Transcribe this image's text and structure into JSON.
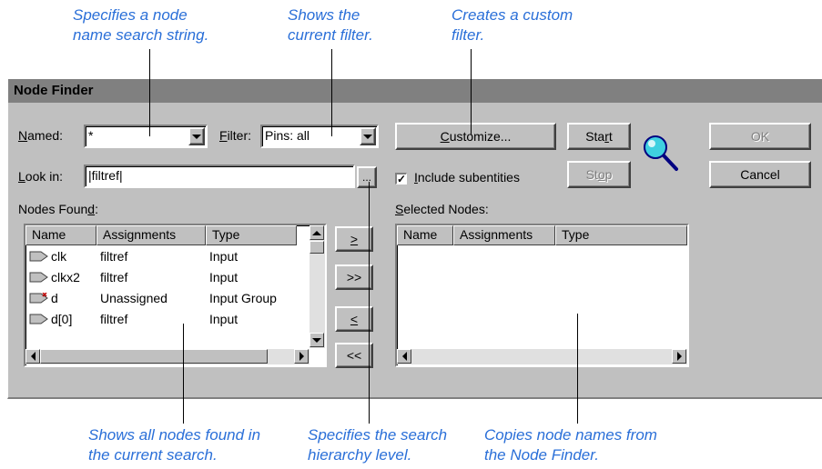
{
  "callouts": {
    "named_l1": "Specifies a node",
    "named_l2": "name search string.",
    "filter_l1": "Shows the",
    "filter_l2": "current filter.",
    "customize_l1": "Creates a custom",
    "customize_l2": "filter.",
    "found_l1": "Shows all nodes found in",
    "found_l2": "the current search.",
    "hier_l1": "Specifies the search",
    "hier_l2": "hierarchy level.",
    "copy_l1": "Copies node names from",
    "copy_l2": "the Node Finder."
  },
  "dialog": {
    "title": "Node Finder",
    "named_label_u": "N",
    "named_label_rest": "amed:",
    "named_value": "*",
    "filter_label_u": "F",
    "filter_label_rest": "ilter:",
    "filter_value": "Pins: all",
    "customize_u": "C",
    "customize_rest": "ustomize...",
    "start_pre": "Sta",
    "start_u": "r",
    "start_post": "t",
    "ok_label": "OK",
    "cancel_label": "Cancel",
    "lookin_label_u": "L",
    "lookin_label_rest": "ook in:",
    "lookin_value": "|filtref|",
    "browse_label": "...",
    "include_u": "I",
    "include_rest": "nclude subentities",
    "include_checked": "✓",
    "stop_pre": "St",
    "stop_u": "o",
    "stop_post": "p",
    "nodes_found_pre": "Nodes Foun",
    "nodes_found_u": "d",
    "nodes_found_post": ":",
    "selected_u": "S",
    "selected_rest": "elected Nodes:",
    "btn_copy_one": ">",
    "btn_copy_all": ">>",
    "btn_remove_one": "<",
    "btn_remove_all": "<<",
    "columns": {
      "name": "Name",
      "assignments": "Assignments",
      "type": "Type"
    },
    "rows": [
      {
        "name": "clk",
        "assignment": "filtref",
        "type": "Input"
      },
      {
        "name": "clkx2",
        "assignment": "filtref",
        "type": "Input"
      },
      {
        "name": "d",
        "assignment": "Unassigned",
        "type": "Input Group"
      },
      {
        "name": "d[0]",
        "assignment": "filtref",
        "type": "Input"
      }
    ]
  }
}
